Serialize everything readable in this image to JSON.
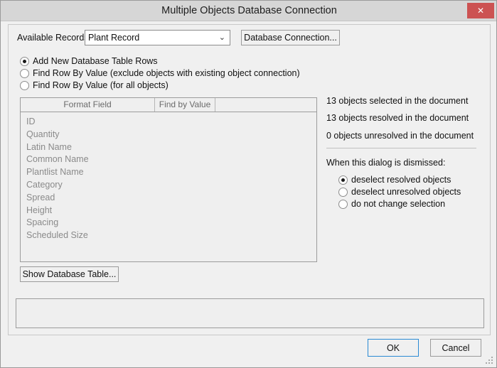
{
  "window": {
    "title": "Multiple Objects Database Connection",
    "close_label": "✕"
  },
  "top_row": {
    "records_label": "Available Records:",
    "records_value": "Plant Record",
    "records_caret": "⌄",
    "db_connection_label": "Database Connection..."
  },
  "mode_options": [
    {
      "label": "Add New Database Table Rows",
      "selected": true
    },
    {
      "label": "Find Row By Value (exclude objects with existing object connection)",
      "selected": false
    },
    {
      "label": "Find Row By Value (for all objects)",
      "selected": false
    }
  ],
  "field_list": {
    "columns": [
      "Format Field",
      "Find by Value",
      ""
    ],
    "rows": [
      "ID",
      "Quantity",
      "Latin Name",
      "Common Name",
      "Plantlist Name",
      "Category",
      "Spread",
      "Height",
      "Spacing",
      "Scheduled Size"
    ]
  },
  "show_db_table_label": "Show Database Table...",
  "info": {
    "selected": "13 objects selected in the document",
    "resolved": "13 objects resolved in the document",
    "unresolved": "0 objects unresolved in the document"
  },
  "dismiss": {
    "title": "When this dialog is dismissed:",
    "options": [
      {
        "label": "deselect resolved objects",
        "selected": true
      },
      {
        "label": "deselect unresolved objects",
        "selected": false
      },
      {
        "label": "do not change selection",
        "selected": false
      }
    ]
  },
  "status_text": "",
  "footer": {
    "ok_label": "OK",
    "cancel_label": "Cancel"
  },
  "colors": {
    "titlebar": "#d6d6d6",
    "dialog_background": "#f0f0f0",
    "close_button": "#cc5252",
    "focus_border": "#2a8ad4",
    "disabled_text": "#8a8a8a",
    "header_text": "#6a6a6a"
  }
}
